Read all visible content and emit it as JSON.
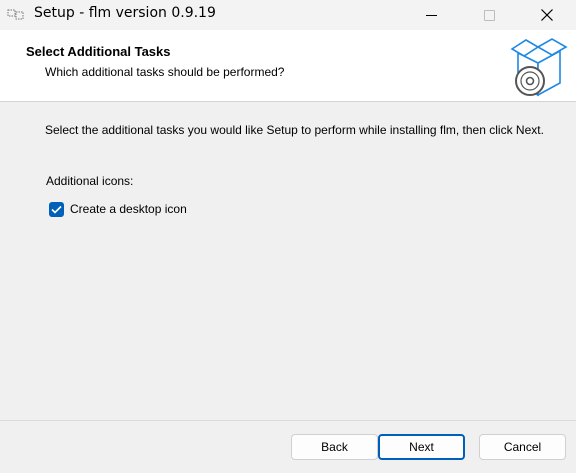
{
  "window": {
    "title": "Setup - flm version 0.9.19",
    "app_icon": "setup-app-icon",
    "controls": [
      "minimize-icon",
      "maximize-icon",
      "close-icon"
    ]
  },
  "header": {
    "title": "Select Additional Tasks",
    "subtitle": "Which additional tasks should be performed?",
    "icon": "box-disc-icon"
  },
  "main": {
    "description": "Select the additional tasks you would like Setup to perform while installing flm, then click Next.",
    "group_label": "Additional icons:",
    "tasks": [
      {
        "label": "Create a desktop icon",
        "checked": true
      }
    ]
  },
  "footer": {
    "back_label": "Back",
    "next_label": "Next",
    "cancel_label": "Cancel"
  },
  "colors": {
    "accent": "#005fb8",
    "background": "#f0f0f0",
    "header_background": "#ffffff"
  }
}
